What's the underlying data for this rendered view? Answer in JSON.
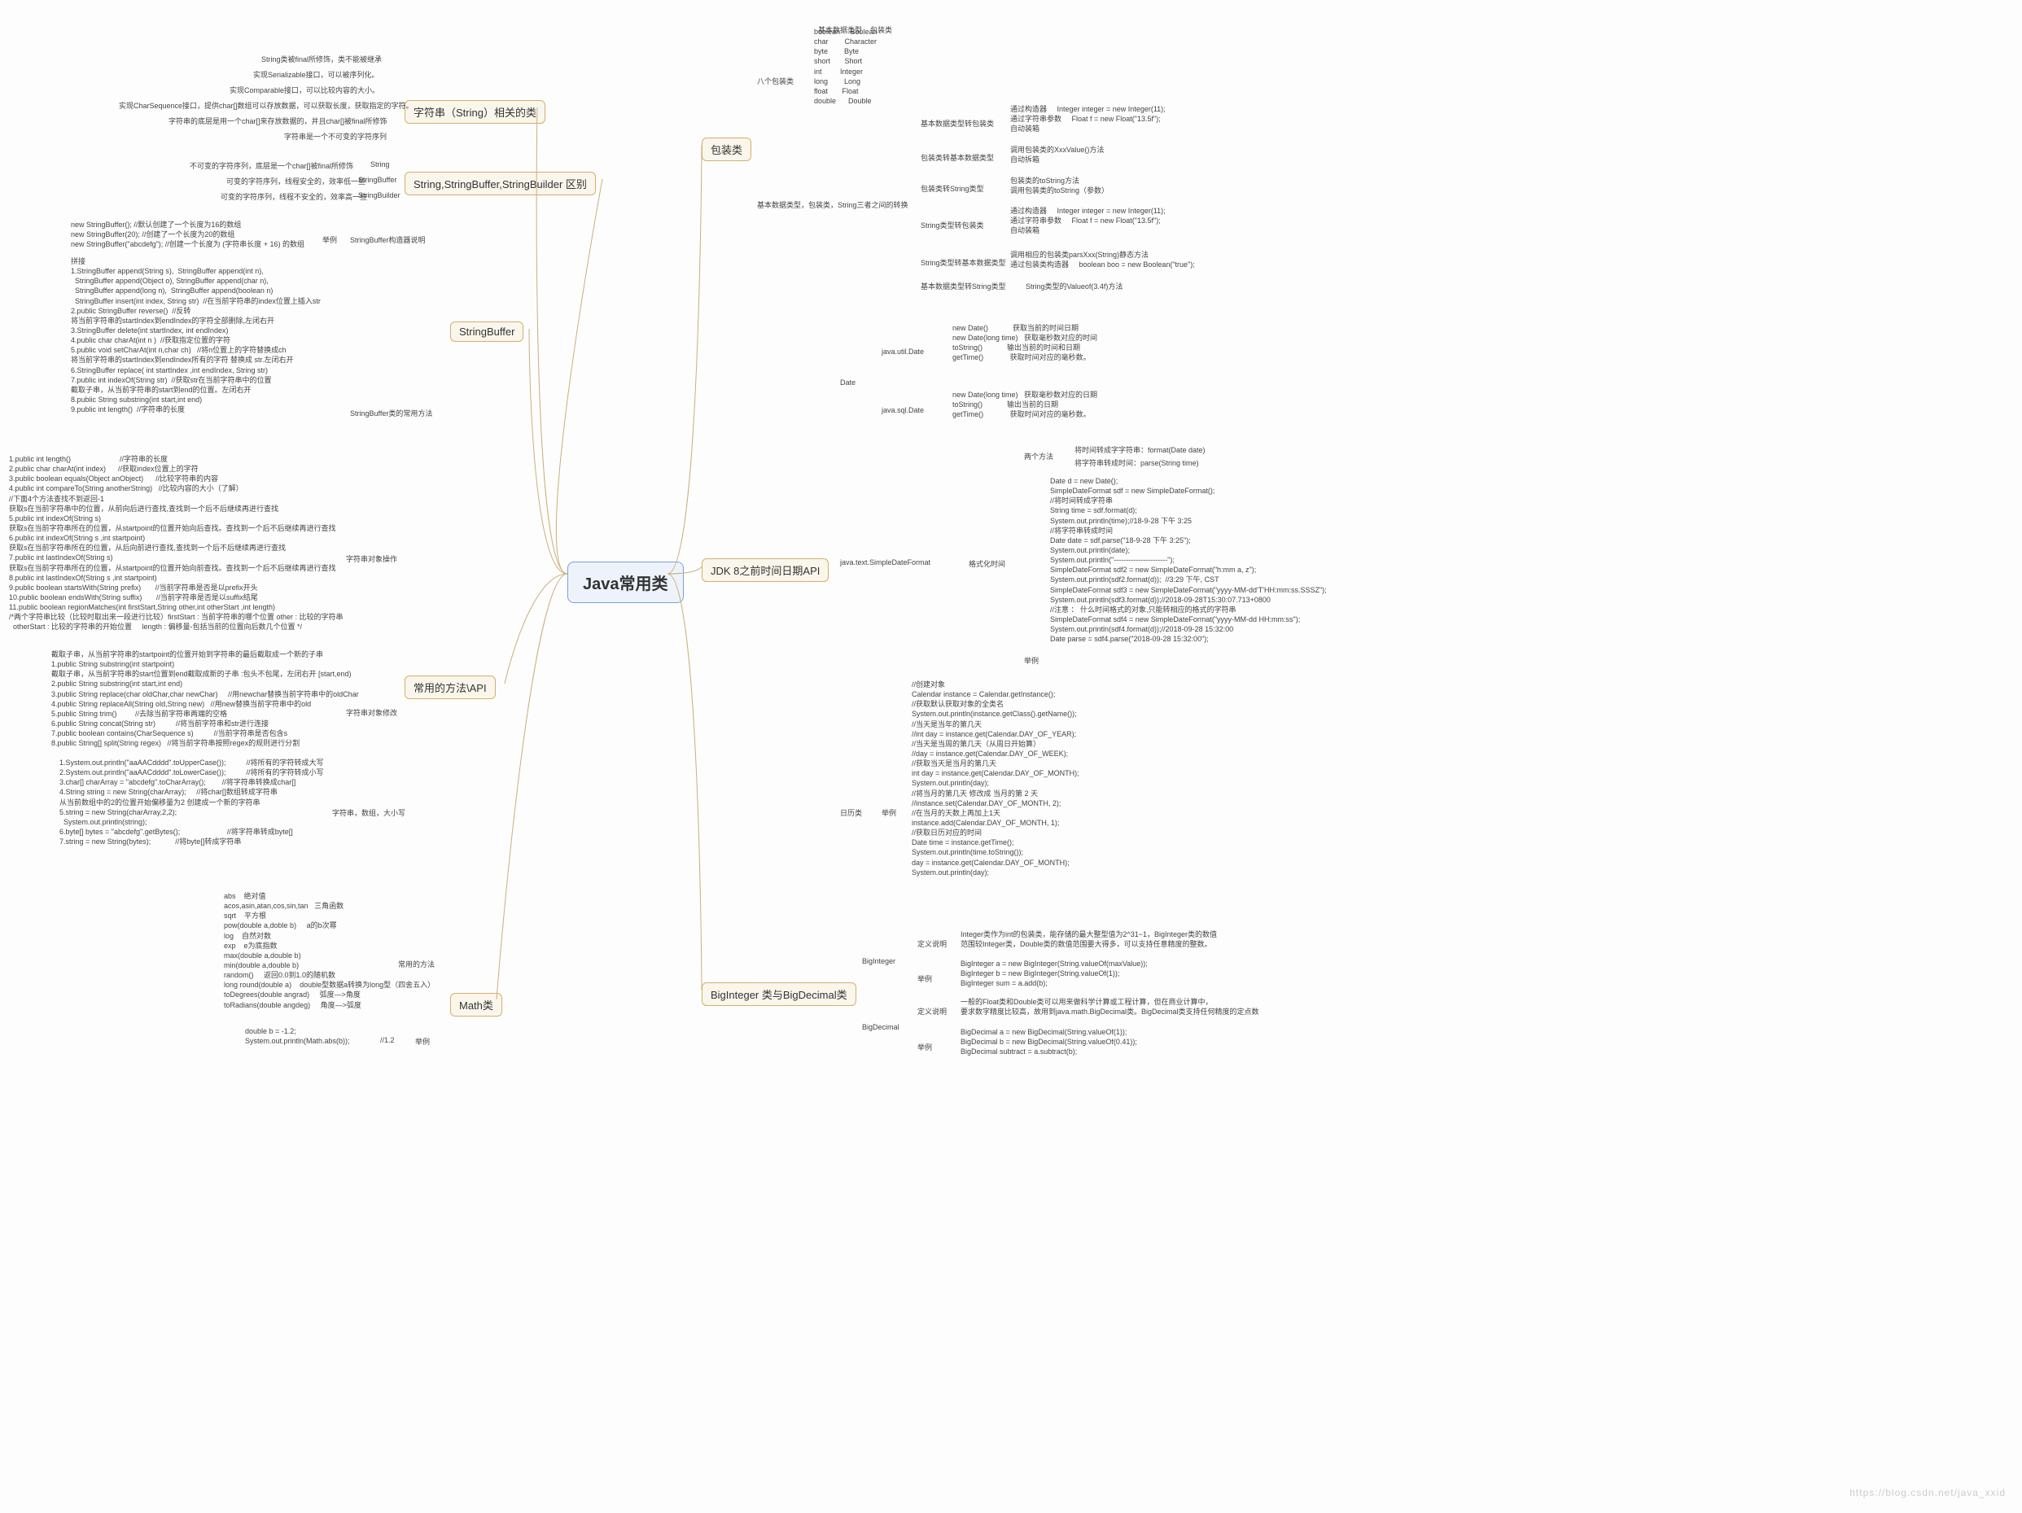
{
  "root": "Java常用类",
  "watermark": "https://blog.csdn.net/java_xxid",
  "left": {
    "string_class": {
      "title": "字符串（String）相关的类",
      "notes": [
        "String类被final所修饰，类不能被继承",
        "实现Serializable接口，可以被序列化。",
        "实现Comparable接口，可以比较内容的大小。",
        "实现CharSequence接口，提供char[]数组可以存放数据，可以获取长度，获取指定的字符。",
        "字符串的底层是用一个char[]来存放数据的，并且char[]被final所修饰",
        "字符串是一个不可变的字符序列"
      ]
    },
    "ssb": {
      "title": "String,StringBuffer,StringBuilder 区别",
      "rows": [
        [
          "不可变的字符序列，底层是一个char[]被final所修饰",
          "String"
        ],
        [
          "可变的字符序列，线程安全的，效率低一些",
          "StringBuffer"
        ],
        [
          "可变的字符序列，线程不安全的，效率高一些",
          "StringBuilder"
        ]
      ]
    },
    "sbuffer": {
      "title": "StringBuffer",
      "ctor_label": "StringBuffer构造器说明",
      "ctor_ex": "举例",
      "ctor": "new StringBuffer(); //默认创建了一个长度为16的数组\nnew StringBuffer(20); //创建了一个长度为20的数组\nnew StringBuffer(\"abcdefg\"); //创建一个长度为 (字符串长度 + 16) 的数组",
      "methods_label": "StringBuffer类的常用方法",
      "methods": "拼接\n1.StringBuffer append(String s),  StringBuffer append(int n),\n  StringBuffer append(Object o), StringBuffer append(char n),\n  StringBuffer append(long n),  StringBuffer append(boolean n)\n  StringBuffer insert(int index, String str)  //在当前字符串的index位置上插入str\n2.public StringBuffer reverse()  //反转\n将当前字符串的startIndex到endIndex的字符全部删除,左闭右开\n3.StringBuffer delete(int startIndex, int endIndex)\n4.public char charAt(int n )  //获取指定位置的字符\n5.public void setCharAt(int n,char ch)   //将n位置上的字符替换成ch\n将当前字符串的startIndex到endIndex所有的字符 替换成 str.左闭右开\n6.StringBuffer replace( int startIndex ,int endIndex, String str)\n7.public int indexOf(String str)  //获取str在当前字符串中的位置\n截取子串，从当前字符串的start到end的位置。左闭右开\n8.public String substring(int start,int end)\n9.public int length()  //字符串的长度"
    },
    "api": {
      "title": "常用的方法\\API",
      "ops_label": "字符串对象操作",
      "ops": "1.public int length()                        //字符串的长度\n2.public char charAt(int index)      //获取index位置上的字符\n3.public boolean equals(Object anObject)      //比较字符串的内容\n4.public int compareTo(String anotherString)   //比较内容的大小（了解）\n//下面4个方法查找不到返回-1\n获取s在当前字符串中的位置，从前向后进行查找,查找到一个后不后继续再进行查找\n5.public int indexOf(String s)\n获取s在当前字符串所在的位置，从startpoint的位置开始向后查找。查找到一个后不后继续再进行查找\n6.public int indexOf(String s ,int startpoint)\n获取s在当前字符串所在的位置，从后向前进行查找,查找到一个后不后继续再进行查找\n7.public int lastIndexOf(String s)\n获取s在当前字符串所在的位置，从startpoint的位置开始向前查找。查找到一个后不后继续再进行查找\n8.public int lastIndexOf(String s ,int startpoint)\n9.public boolean startsWith(String prefix)       //当前字符串是否是以prefix开头\n10.public boolean endsWith(String suffix)       //当前字符串是否是以suffix结尾\n11.public boolean regionMatches(int firstStart,String other,int otherStart ,int length)\n/*两个字符串比较（比较时取出来一段进行比较）firstStart : 当前字符串的哪个位置 other : 比较的字符串\n  otherStart : 比较的字符串的开始位置     length : 偏移量-包括当前的位置向后数几个位置 */",
      "mod_label": "字符串对象修改",
      "mod": "截取子串，从当前字符串的startpoint的位置开始到字符串的最后截取成一个新的子串\n1.public String substring(int startpoint)\n截取子串，从当前字符串的start位置到end截取成新的子串 :包头不包尾，左闭右开 [start,end)\n2.public String substring(int start,int end)\n3.public String replace(char oldChar,char newChar)     //用newchar替换当前字符串中的oldChar\n4.public String replaceAll(String old,String new)   //用new替换当前字符串中的old\n5.public String trim()         //去除当前字符串两端的空格\n6.public String concat(String str)          //将当前字符串和str进行连接\n7.public boolean contains(CharSequence s)          //当前字符串是否包含s\n8.public String[] split(String regex)   //将当前字符串按照regex的规则进行分割",
      "case_label": "字符串，数组，大小写",
      "case": "1.System.out.println(\"aaAACdddd\".toUpperCase());          //将所有的字符转成大写\n2.System.out.println(\"aaAACdddd\".toLowerCase());          //将所有的字符转成小写\n3.char[] charArray = \"abcdefg\".toCharArray();        //将字符串转换成char[]\n4.String string = new String(charArray);     //将char[]数组转成字符串\n从当前数组中的2的位置开始偏移量为2 创建成一个新的字符串\n5.string = new String(charArray,2,2);\n  System.out.println(string);\n6.byte[] bytes = \"abcdefg\".getBytes();                       //将字符串转成byte[]\n7.string = new String(bytes);            //将byte[]转成字符串"
    },
    "math": {
      "title": "Math类",
      "methods_label": "常用的方法",
      "methods": "abs    绝对值\nacos,asin,atan,cos,sin,tan   三角函数\nsqrt    平方根\npow(double a,doble b)     a的b次幂\nlog    自然对数\nexp    e为底指数\nmax(double a,double b)\nmin(double a,double b)\nrandom()     返回0.0到1.0的随机数\nlong round(double a)    double型数据a转换为long型（四舍五入）\ntoDegrees(double angrad)     弧度—>角度\ntoRadians(double angdeg)     角度—>弧度",
      "ex_label": "举例",
      "ex_val": "//1.2",
      "ex": "double b = -1.2;\nSystem.out.println(Math.abs(b));"
    }
  },
  "right": {
    "wrapper": {
      "title": "包装类",
      "eight_label": "八个包装类",
      "table_hdr": [
        "基本数据类型",
        "包装类"
      ],
      "table": [
        [
          "boolean",
          "Boolean"
        ],
        [
          "char",
          "Character"
        ],
        [
          "byte",
          "Byte"
        ],
        [
          "short",
          "Short"
        ],
        [
          "int",
          "Integer"
        ],
        [
          "long",
          "Long"
        ],
        [
          "float",
          "Float"
        ],
        [
          "double",
          "Double"
        ]
      ],
      "conv_label": "基本数据类型，包装类，String三者之间的转换",
      "p2w": {
        "label": "基本数据类型转包装类",
        "items": [
          [
            "通过构造器",
            "Integer integer = new Integer(11);"
          ],
          [
            "通过字符串参数",
            "Float f = new Float(\"13.5f\");"
          ],
          [
            "自动装箱",
            ""
          ]
        ]
      },
      "w2p": {
        "label": "包装类转基本数据类型",
        "items": [
          [
            "调用包装类的XxxValue()方法",
            ""
          ],
          [
            "自动拆箱",
            ""
          ]
        ]
      },
      "w2s": {
        "label": "包装类转String类型",
        "items": [
          [
            "包装类的toString方法",
            ""
          ],
          [
            "调用包装类的toString（参数）",
            ""
          ]
        ]
      },
      "s2w": {
        "label": "String类型转包装类",
        "items": [
          [
            "通过构造器",
            "Integer integer = new Integer(11);"
          ],
          [
            "通过字符串参数",
            "Float f = new Float(\"13.5f\");"
          ],
          [
            "自动装箱",
            ""
          ]
        ]
      },
      "s2p": {
        "label": "String类型转基本数据类型",
        "items": [
          [
            "调用相应的包装类parsXxx(String)静态方法",
            ""
          ],
          [
            "通过包装类构造器",
            "boolean boo = new Boolean(\"true\");"
          ]
        ]
      },
      "p2s": {
        "label": "基本数据类型转String类型",
        "item": "String类型的Valueof(3.4f)方法"
      }
    },
    "jdk8": {
      "title": "JDK 8之前时间日期API",
      "date_label": "Date",
      "util": {
        "label": "java.util.Date",
        "rows": [
          [
            "new Date()",
            "获取当前的时间日期"
          ],
          [
            "new Date(long time)",
            "获取毫秒数对应的时间"
          ],
          [
            "toString()",
            "输出当前的时间和日期"
          ],
          [
            "getTime()",
            "获取时间对应的毫秒数。"
          ]
        ]
      },
      "sql": {
        "label": "java.sql.Date",
        "rows": [
          [
            "new Date(long time)",
            "获取毫秒数对应的日期"
          ],
          [
            "toString()",
            "输出当前的日期"
          ],
          [
            "getTime()",
            "获取时间对应的毫秒数。"
          ]
        ]
      },
      "sdf": {
        "label": "java.text.SimpleDateFormat",
        "fmt_label": "格式化时间",
        "two_label": "两个方法",
        "two": [
          "将时间转成字字符串：format(Date date)",
          "将字符串转成时间：parse(String time)"
        ],
        "ex_label": "举例",
        "ex": "Date d = new Date();\nSimpleDateFormat sdf = new SimpleDateFormat();\n//将时间转成字符串\nString time = sdf.format(d);\nSystem.out.println(time);//18-9-28 下午 3:25\n//将字符串转成时间\nDate date = sdf.parse(\"18-9-28 下午 3:25\");\nSystem.out.println(date);\nSystem.out.println(\"----------------------\");\nSimpleDateFormat sdf2 = new SimpleDateFormat(\"h:mm a, z\");\nSystem.out.println(sdf2.format(d));  //3:29 下午, CST\nSimpleDateFormat sdf3 = new SimpleDateFormat(\"yyyy-MM-dd'T'HH:mm:ss.SSSZ\");\nSystem.out.println(sdf3.format(d));//2018-09-28T15:30:07.713+0800\n//注意 ： 什么时间格式的对象,只能转相应的格式的字符串\nSimpleDateFormat sdf4 = new SimpleDateFormat(\"yyyy-MM-dd HH:mm:ss\");\nSystem.out.println(sdf4.format(d));//2018-09-28 15:32:00\nDate parse = sdf4.parse(\"2018-09-28 15:32:00\");"
      },
      "cal": {
        "label": "日历类",
        "ex_label": "举例",
        "ex": "//创建对象\nCalendar instance = Calendar.getInstance();\n//获取默认获取对象的全类名\nSystem.out.println(instance.getClass().getName());\n//当天是当年的第几天\n//int day = instance.get(Calendar.DAY_OF_YEAR);\n//当天是当周的第几天（从周日开始算）\n//day = instance.get(Calendar.DAY_OF_WEEK);\n//获取当天是当月的第几天\nint day = instance.get(Calendar.DAY_OF_MONTH);\nSystem.out.println(day);\n//将当月的第几天 修改成 当月的第 2 天\n//instance.set(Calendar.DAY_OF_MONTH, 2);\n//在当月的天数上再加上1天\ninstance.add(Calendar.DAY_OF_MONTH, 1);\n//获取日历对应的时间\nDate time = instance.getTime();\nSystem.out.println(time.toString());\nday = instance.get(Calendar.DAY_OF_MONTH);\nSystem.out.println(day);"
      }
    },
    "big": {
      "title": "BigInteger 类与BigDecimal类",
      "bi": {
        "label": "BigInteger",
        "def_label": "定义说明",
        "def": "Integer类作为int的包装类，能存储的最大整型值为2^31−1，BigInteger类的数值\n范围较Integer类，Double类的数值范围要大得多，可以支持任意精度的整数。",
        "ex_label": "举例",
        "ex": "BigInteger a = new BigInteger(String.valueOf(maxValue));\nBigInteger b = new BigInteger(String.valueOf(1));\nBigInteger sum = a.add(b);"
      },
      "bd": {
        "label": "BigDecimal",
        "def_label": "定义说明",
        "def": "一般的Float类和Double类可以用来做科学计算或工程计算，但在商业计算中，\n要求数字精度比较高，故用到java.math.BigDecimal类。BigDecimal类支持任何精度的定点数",
        "ex_label": "举例",
        "ex": "BigDecimal a = new BigDecimal(String.valueOf(1));\nBigDecimal b = new BigDecimal(String.valueOf(0.41));\nBigDecimal subtract = a.subtract(b);"
      }
    }
  }
}
